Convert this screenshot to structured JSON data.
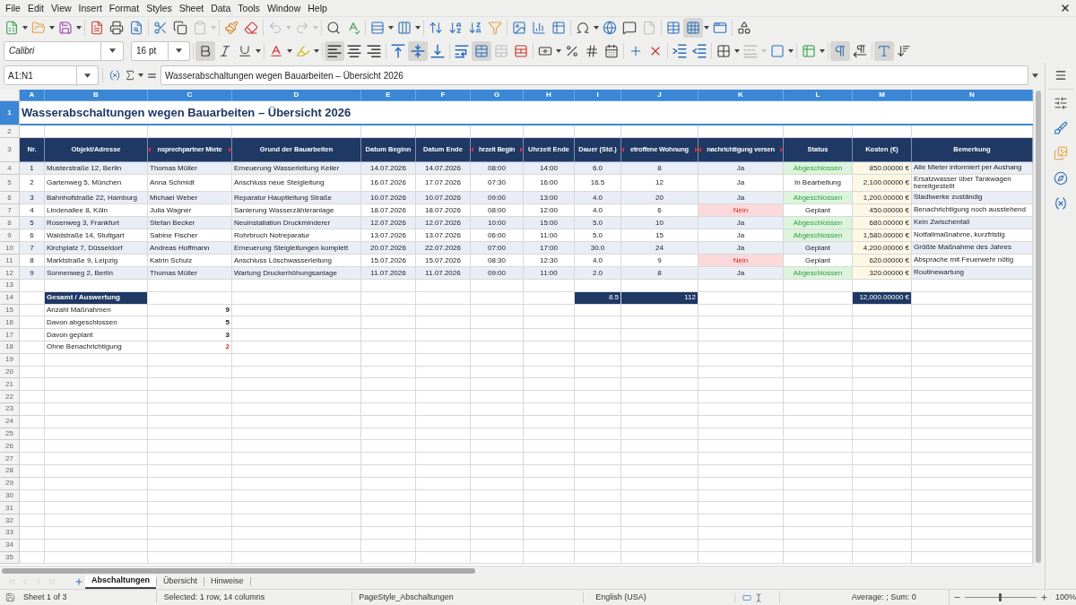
{
  "menu_bar": {
    "items": [
      "File",
      "Edit",
      "View",
      "Insert",
      "Format",
      "Styles",
      "Sheet",
      "Data",
      "Tools",
      "Window",
      "Help"
    ]
  },
  "standard_toolbar": {
    "groups": [
      {
        "tools": [
          {
            "kind": "new",
            "pressed": false,
            "disabled": false,
            "dropdown": true
          },
          {
            "kind": "open",
            "pressed": false,
            "disabled": false,
            "dropdown": true
          },
          {
            "kind": "save",
            "pressed": false,
            "disabled": false,
            "dropdown": true
          }
        ]
      },
      {
        "tools": [
          {
            "kind": "export_pdf",
            "pressed": false,
            "disabled": false,
            "dropdown": false
          },
          {
            "kind": "print",
            "pressed": false,
            "disabled": false,
            "dropdown": false
          },
          {
            "kind": "preview",
            "pressed": false,
            "disabled": false,
            "dropdown": false
          }
        ]
      },
      {
        "tools": [
          {
            "kind": "cut",
            "pressed": false,
            "disabled": false,
            "dropdown": false
          },
          {
            "kind": "copy",
            "pressed": false,
            "disabled": false,
            "dropdown": false
          },
          {
            "kind": "paste",
            "pressed": false,
            "disabled": true,
            "dropdown": true
          }
        ]
      },
      {
        "tools": [
          {
            "kind": "clone",
            "pressed": false,
            "disabled": false,
            "dropdown": false
          },
          {
            "kind": "clear",
            "pressed": false,
            "disabled": false,
            "dropdown": false
          }
        ]
      },
      {
        "tools": [
          {
            "kind": "undo",
            "pressed": false,
            "disabled": true,
            "dropdown": true
          },
          {
            "kind": "redo",
            "pressed": false,
            "disabled": true,
            "dropdown": true
          }
        ]
      },
      {
        "tools": [
          {
            "kind": "find",
            "pressed": false,
            "disabled": false,
            "dropdown": false
          },
          {
            "kind": "spelling",
            "pressed": false,
            "disabled": false,
            "dropdown": false
          }
        ]
      },
      {
        "tools": [
          {
            "kind": "rows",
            "pressed": false,
            "disabled": false,
            "dropdown": true
          },
          {
            "kind": "columns",
            "pressed": false,
            "disabled": false,
            "dropdown": true
          }
        ]
      },
      {
        "tools": [
          {
            "kind": "sort",
            "pressed": false,
            "disabled": false,
            "dropdown": false
          },
          {
            "kind": "sort_asc",
            "pressed": false,
            "disabled": false,
            "dropdown": false
          },
          {
            "kind": "sort_desc",
            "pressed": false,
            "disabled": false,
            "dropdown": false
          },
          {
            "kind": "autofilter",
            "pressed": false,
            "disabled": false,
            "dropdown": false
          }
        ]
      },
      {
        "tools": [
          {
            "kind": "image",
            "pressed": false,
            "disabled": false,
            "dropdown": false
          },
          {
            "kind": "chart",
            "pressed": false,
            "disabled": false,
            "dropdown": false
          },
          {
            "kind": "pivot",
            "pressed": false,
            "disabled": false,
            "dropdown": false
          }
        ]
      },
      {
        "tools": [
          {
            "kind": "special",
            "pressed": false,
            "disabled": false,
            "dropdown": true
          },
          {
            "kind": "hyperlink",
            "pressed": false,
            "disabled": false,
            "dropdown": false
          },
          {
            "kind": "comment",
            "pressed": false,
            "disabled": false,
            "dropdown": false
          },
          {
            "kind": "headers",
            "pressed": false,
            "disabled": true,
            "dropdown": false
          }
        ]
      },
      {
        "tools": [
          {
            "kind": "print_area",
            "pressed": false,
            "disabled": false,
            "dropdown": false
          },
          {
            "kind": "freeze",
            "pressed": true,
            "disabled": false,
            "dropdown": true
          },
          {
            "kind": "split",
            "pressed": false,
            "disabled": false,
            "dropdown": false
          }
        ]
      },
      {
        "tools": [
          {
            "kind": "draw",
            "pressed": false,
            "disabled": false,
            "dropdown": false
          }
        ]
      }
    ]
  },
  "formatting_toolbar": {
    "font_name": "Calibri",
    "font_size": "16 pt",
    "groups": [
      {
        "tools": [
          {
            "kind": "bold",
            "pressed": true,
            "disabled": false,
            "dropdown": false
          },
          {
            "kind": "italic",
            "pressed": false,
            "disabled": false,
            "dropdown": false
          },
          {
            "kind": "underline",
            "pressed": false,
            "disabled": false,
            "dropdown": true
          }
        ]
      },
      {
        "tools": [
          {
            "kind": "font_color",
            "pressed": false,
            "disabled": false,
            "dropdown": true
          },
          {
            "kind": "highlight",
            "pressed": false,
            "disabled": false,
            "dropdown": true
          }
        ]
      },
      {
        "tools": [
          {
            "kind": "align_left",
            "pressed": true,
            "disabled": false,
            "dropdown": false
          },
          {
            "kind": "align_center",
            "pressed": false,
            "disabled": false,
            "dropdown": false
          },
          {
            "kind": "align_right",
            "pressed": false,
            "disabled": false,
            "dropdown": false
          }
        ]
      },
      {
        "tools": [
          {
            "kind": "align_top",
            "pressed": false,
            "disabled": false,
            "dropdown": false
          },
          {
            "kind": "align_middle",
            "pressed": true,
            "disabled": false,
            "dropdown": false
          },
          {
            "kind": "align_bottom",
            "pressed": false,
            "disabled": false,
            "dropdown": false
          }
        ]
      },
      {
        "tools": [
          {
            "kind": "wrap",
            "pressed": false,
            "disabled": false,
            "dropdown": false
          },
          {
            "kind": "merge_center",
            "pressed": true,
            "disabled": false,
            "dropdown": false
          },
          {
            "kind": "merge",
            "pressed": false,
            "disabled": true,
            "dropdown": false
          },
          {
            "kind": "unmerge",
            "pressed": false,
            "disabled": false,
            "dropdown": false
          }
        ]
      },
      {
        "tools": [
          {
            "kind": "currency",
            "pressed": false,
            "disabled": false,
            "dropdown": true
          },
          {
            "kind": "percent",
            "pressed": false,
            "disabled": false,
            "dropdown": false
          },
          {
            "kind": "number",
            "pressed": false,
            "disabled": false,
            "dropdown": false
          },
          {
            "kind": "date",
            "pressed": false,
            "disabled": false,
            "dropdown": false
          }
        ]
      },
      {
        "tools": [
          {
            "kind": "add_decimal",
            "pressed": false,
            "disabled": false,
            "dropdown": false
          },
          {
            "kind": "delete_decimal",
            "pressed": false,
            "disabled": false,
            "dropdown": false
          }
        ]
      },
      {
        "tools": [
          {
            "kind": "indent_more",
            "pressed": false,
            "disabled": false,
            "dropdown": false
          },
          {
            "kind": "indent_less",
            "pressed": false,
            "disabled": false,
            "dropdown": false
          }
        ]
      },
      {
        "tools": [
          {
            "kind": "borders",
            "pressed": false,
            "disabled": false,
            "dropdown": true
          },
          {
            "kind": "border_style",
            "pressed": false,
            "disabled": true,
            "dropdown": true
          },
          {
            "kind": "border_color",
            "pressed": false,
            "disabled": false,
            "dropdown": true
          }
        ]
      },
      {
        "tools": [
          {
            "kind": "conditional",
            "pressed": false,
            "disabled": false,
            "dropdown": true
          }
        ]
      },
      {
        "tools": [
          {
            "kind": "ltr",
            "pressed": true,
            "disabled": false,
            "dropdown": false
          },
          {
            "kind": "rtl",
            "pressed": false,
            "disabled": false,
            "dropdown": false
          }
        ]
      },
      {
        "tools": [
          {
            "kind": "text_direction",
            "pressed": true,
            "disabled": false,
            "dropdown": false
          },
          {
            "kind": "vertical_text",
            "pressed": false,
            "disabled": false,
            "dropdown": false
          }
        ]
      }
    ]
  },
  "formula_bar": {
    "name_box": "A1:N1",
    "value": "Wasserabschaltungen wegen Bauarbeiten – Übersicht 2026"
  },
  "sheet": {
    "column_headers": [
      {
        "label": "A",
        "selected": true
      },
      {
        "label": "B",
        "selected": true
      },
      {
        "label": "C",
        "selected": true
      },
      {
        "label": "D",
        "selected": true
      },
      {
        "label": "E",
        "selected": true
      },
      {
        "label": "F",
        "selected": true
      },
      {
        "label": "G",
        "selected": true
      },
      {
        "label": "H",
        "selected": true
      },
      {
        "label": "I",
        "selected": true
      },
      {
        "label": "J",
        "selected": true
      },
      {
        "label": "K",
        "selected": true
      },
      {
        "label": "L",
        "selected": true
      },
      {
        "label": "M",
        "selected": true
      },
      {
        "label": "N",
        "selected": true
      }
    ],
    "row_headers": [
      {
        "label": "1",
        "selected": true
      },
      {
        "label": "2",
        "selected": false
      },
      {
        "label": "3",
        "selected": false
      },
      {
        "label": "4",
        "selected": false
      },
      {
        "label": "5",
        "selected": false
      },
      {
        "label": "6",
        "selected": false
      },
      {
        "label": "7",
        "selected": false
      },
      {
        "label": "8",
        "selected": false
      },
      {
        "label": "9",
        "selected": false
      },
      {
        "label": "10",
        "selected": false
      },
      {
        "label": "11",
        "selected": false
      },
      {
        "label": "12",
        "selected": false
      },
      {
        "label": "13",
        "selected": false
      },
      {
        "label": "14",
        "selected": false
      },
      {
        "label": "15",
        "selected": false
      },
      {
        "label": "16",
        "selected": false
      },
      {
        "label": "17",
        "selected": false
      },
      {
        "label": "18",
        "selected": false
      },
      {
        "label": "19",
        "selected": false
      },
      {
        "label": "20",
        "selected": false
      },
      {
        "label": "21",
        "selected": false
      },
      {
        "label": "22",
        "selected": false
      },
      {
        "label": "23",
        "selected": false
      },
      {
        "label": "24",
        "selected": false
      },
      {
        "label": "25",
        "selected": false
      },
      {
        "label": "26",
        "selected": false
      },
      {
        "label": "27",
        "selected": false
      },
      {
        "label": "28",
        "selected": false
      },
      {
        "label": "29",
        "selected": false
      },
      {
        "label": "30",
        "selected": false
      },
      {
        "label": "31",
        "selected": false
      },
      {
        "label": "32",
        "selected": false
      },
      {
        "label": "33",
        "selected": false
      },
      {
        "label": "34",
        "selected": false
      },
      {
        "label": "35",
        "selected": false
      }
    ],
    "title": "Wasserabschaltungen wegen Bauarbeiten – Übersicht 2026",
    "table_header": [
      {
        "text": "Nr.",
        "clipped": false
      },
      {
        "text": "Objekt/Adresse",
        "clipped": false
      },
      {
        "text": "nsprechpartner Miete",
        "clipped": true
      },
      {
        "text": "Grund der Bauarbeiten",
        "clipped": false
      },
      {
        "text": "Datum Beginn",
        "clipped": false
      },
      {
        "text": "Datum Ende",
        "clipped": false
      },
      {
        "text": "hrzeit Begin",
        "clipped": true
      },
      {
        "text": "Uhrzeit Ende",
        "clipped": false
      },
      {
        "text": "Dauer (Std.)",
        "clipped": false
      },
      {
        "text": "etroffene Wohnung",
        "clipped": true
      },
      {
        "text": "nachrichtigung versen",
        "clipped": true
      },
      {
        "text": "Status",
        "clipped": false
      },
      {
        "text": "Kosten (€)",
        "clipped": false
      },
      {
        "text": "Bemerkung",
        "clipped": false
      }
    ],
    "rows": [
      {
        "nr": "1",
        "address": "Musterstraße 12, Berlin",
        "contact": "Thomas Müller",
        "reason": "Erneuerung Wasserleitung Keller",
        "start_date": "14.07.2026",
        "end_date": "14.07.2026",
        "start_time": "08:00",
        "end_time": "14:00",
        "duration": "6.0",
        "apartments": "8",
        "notified": {
          "text": "Ja",
          "warning": false
        },
        "status": {
          "text": "Abgeschlossen",
          "done": true
        },
        "cost": "850.00000 €",
        "remark": "Alle Mieter informiert per Aushang"
      },
      {
        "nr": "2",
        "address": "Gartenweg 5, München",
        "contact": "Anna Schmidt",
        "reason": "Anschluss neue Steigleitung",
        "start_date": "16.07.2026",
        "end_date": "17.07.2026",
        "start_time": "07:30",
        "end_time": "16:00",
        "duration": "16.5",
        "apartments": "12",
        "notified": {
          "text": "Ja",
          "warning": false
        },
        "status": {
          "text": "In Bearbeitung",
          "done": false
        },
        "cost": "2,100.00000 €",
        "remark": "Ersatzwasser über Tankwagen bereitgestellt"
      },
      {
        "nr": "3",
        "address": "Bahnhofstraße 22, Hamburg",
        "contact": "Michael Weber",
        "reason": "Reparatur Hauptleitung Straße",
        "start_date": "10.07.2026",
        "end_date": "10.07.2026",
        "start_time": "09:00",
        "end_time": "13:00",
        "duration": "4.0",
        "apartments": "20",
        "notified": {
          "text": "Ja",
          "warning": false
        },
        "status": {
          "text": "Abgeschlossen",
          "done": true
        },
        "cost": "1,200.00000 €",
        "remark": "Stadtwerke zuständig"
      },
      {
        "nr": "4",
        "address": "Lindenallee 8, Köln",
        "contact": "Julia Wagner",
        "reason": "Sanierung Wasserzähleranlage",
        "start_date": "18.07.2026",
        "end_date": "18.07.2026",
        "start_time": "08:00",
        "end_time": "12:00",
        "duration": "4.0",
        "apartments": "6",
        "notified": {
          "text": "Nein",
          "warning": true
        },
        "status": {
          "text": "Geplant",
          "done": false
        },
        "cost": "450.00000 €",
        "remark": "Benachrichtigung noch ausstehend"
      },
      {
        "nr": "5",
        "address": "Rosenweg 3, Frankfurt",
        "contact": "Stefan Becker",
        "reason": "Neuinstallation Druckminderer",
        "start_date": "12.07.2026",
        "end_date": "12.07.2026",
        "start_time": "10:00",
        "end_time": "15:00",
        "duration": "5.0",
        "apartments": "10",
        "notified": {
          "text": "Ja",
          "warning": false
        },
        "status": {
          "text": "Abgeschlossen",
          "done": true
        },
        "cost": "680.00000 €",
        "remark": "Kein Zwischenfall"
      },
      {
        "nr": "6",
        "address": "Waldstraße 14, Stuttgart",
        "contact": "Sabine Fischer",
        "reason": "Rohrbruch Notreparatur",
        "start_date": "13.07.2026",
        "end_date": "13.07.2026",
        "start_time": "06:00",
        "end_time": "11:00",
        "duration": "5.0",
        "apartments": "15",
        "notified": {
          "text": "Ja",
          "warning": false
        },
        "status": {
          "text": "Abgeschlossen",
          "done": true
        },
        "cost": "1,580.00000 €",
        "remark": "Notfallmaßnahme, kurzfristig"
      },
      {
        "nr": "7",
        "address": "Kirchplatz 7, Düsseldorf",
        "contact": "Andreas Hoffmann",
        "reason": "Erneuerung Steigleitungen komplett",
        "start_date": "20.07.2026",
        "end_date": "22.07.2026",
        "start_time": "07:00",
        "end_time": "17:00",
        "duration": "30.0",
        "apartments": "24",
        "notified": {
          "text": "Ja",
          "warning": false
        },
        "status": {
          "text": "Geplant",
          "done": false
        },
        "cost": "4,200.00000 €",
        "remark": "Größte Maßnahme des Jahres"
      },
      {
        "nr": "8",
        "address": "Marktstraße 9, Leipzig",
        "contact": "Katrin Schulz",
        "reason": "Anschluss Löschwasserleitung",
        "start_date": "15.07.2026",
        "end_date": "15.07.2026",
        "start_time": "08:30",
        "end_time": "12:30",
        "duration": "4.0",
        "apartments": "9",
        "notified": {
          "text": "Nein",
          "warning": true
        },
        "status": {
          "text": "Geplant",
          "done": false
        },
        "cost": "620.00000 €",
        "remark": "Absprache mit Feuerwehr nötig"
      },
      {
        "nr": "9",
        "address": "Sonnenweg 2, Berlin",
        "contact": "Thomas Müller",
        "reason": "Wartung Druckerhöhungsanlage",
        "start_date": "11.07.2026",
        "end_date": "11.07.2026",
        "start_time": "09:00",
        "end_time": "11:00",
        "duration": "2.0",
        "apartments": "8",
        "notified": {
          "text": "Ja",
          "warning": false
        },
        "status": {
          "text": "Abgeschlossen",
          "done": true
        },
        "cost": "320.00000 €",
        "remark": "Routinewartung"
      }
    ],
    "totals": {
      "label": "Gesamt / Auswertung",
      "duration": "8.5",
      "apartments": "112",
      "cost": "12,000.00000 €"
    },
    "summary": [
      {
        "label": "Anzahl Maßnahmen",
        "value": "9",
        "alert": false
      },
      {
        "label": "Davon abgeschlossen",
        "value": "5",
        "alert": false
      },
      {
        "label": "Davon geplant",
        "value": "3",
        "alert": false
      },
      {
        "label": "Ohne Benachrichtigung",
        "value": "2",
        "alert": true
      }
    ]
  },
  "sheet_tabs": {
    "nav_disabled": true,
    "tabs": [
      {
        "label": "Abschaltungen",
        "selected": true
      },
      {
        "label": "Übersicht",
        "selected": false
      },
      {
        "label": "Hinweise",
        "selected": false
      }
    ]
  },
  "status_bar": {
    "sheet": "Sheet 1 of 3",
    "selection": "Selected: 1 row, 14 columns",
    "page_style": "PageStyle_Abschaltungen",
    "language": "English (USA)",
    "summary": "Average: ; Sum: 0",
    "zoom": {
      "level": 0.5,
      "label": "100%"
    }
  }
}
